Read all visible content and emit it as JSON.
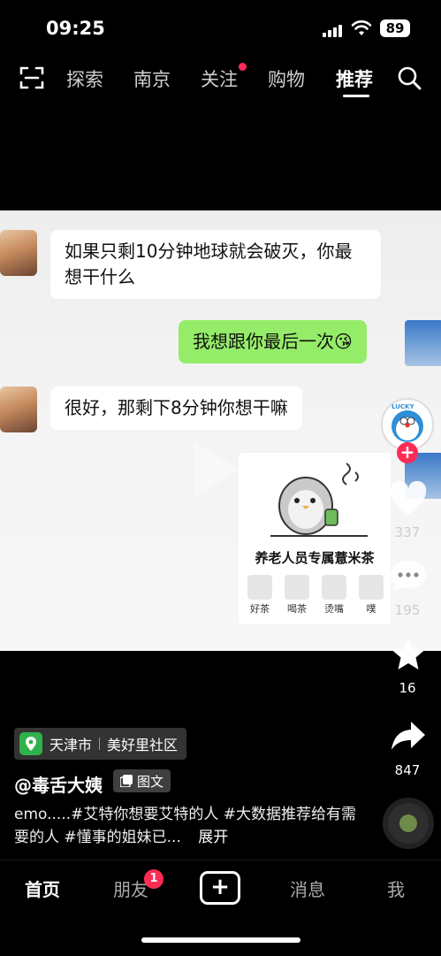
{
  "status_bar": {
    "time": "09:25",
    "battery": "89"
  },
  "top_nav": {
    "tabs": [
      {
        "label": "探索"
      },
      {
        "label": "南京"
      },
      {
        "label": "关注"
      },
      {
        "label": "购物"
      },
      {
        "label": "推荐"
      }
    ],
    "active_tab": "推荐"
  },
  "chat": {
    "msg1": "如果只剩10分钟地球就会破灭，你最想干什么",
    "msg2": "我想跟你最后一次😘",
    "msg3": "很好，那剩下8分钟你想干嘛",
    "sticker_caption": "养老人员专属薏米茶",
    "sticker_labels": [
      "好茶",
      "喝茶",
      "烫嘴",
      "噗"
    ]
  },
  "right_rail": {
    "avatar_text": "LUCKY",
    "likes": "337",
    "comments": "195",
    "favorites": "16",
    "shares": "847"
  },
  "post": {
    "location_city": "天津市",
    "location_place": "美好里社区",
    "username": "@毒舌大姨",
    "type_label": "图文",
    "description": "emo.....#艾特你想要艾特的人 #大数据推荐给有需要的人 #懂事的姐妹已...",
    "expand_label": "展开"
  },
  "bottom_tabs": {
    "home": "首页",
    "friends": "朋友",
    "friends_badge": "1",
    "messages": "消息",
    "me": "我"
  }
}
